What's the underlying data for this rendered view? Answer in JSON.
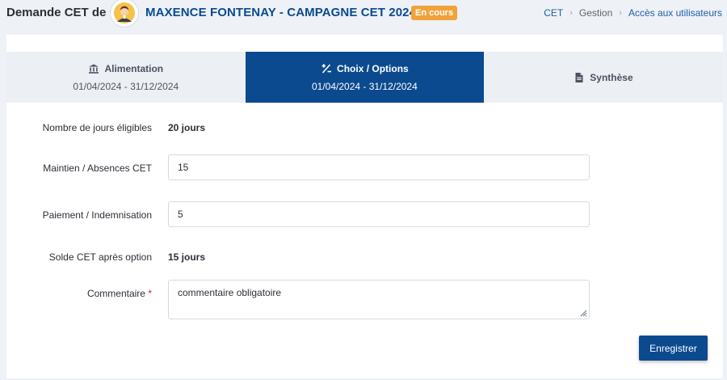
{
  "header": {
    "prefix": "Demande CET de",
    "person": "MAXENCE FONTENAY - CAMPAGNE CET 2024",
    "status_badge": "En cours",
    "breadcrumb": [
      "CET",
      "Gestion",
      "Accès aux utilisateurs"
    ]
  },
  "tabs": [
    {
      "label": "Alimentation",
      "dates": "01/04/2024 - 31/12/2024",
      "icon": "bank-icon",
      "active": false
    },
    {
      "label": "Choix / Options",
      "dates": "01/04/2024 - 31/12/2024",
      "icon": "percent-icon",
      "active": true
    },
    {
      "label": "Synthèse",
      "dates": "",
      "icon": "document-icon",
      "active": false
    }
  ],
  "form": {
    "eligible_label": "Nombre de jours éligibles",
    "eligible_value": "20 jours",
    "maintien_label": "Maintien / Absences CET",
    "maintien_value": "15",
    "paiement_label": "Paiement / Indemnisation",
    "paiement_value": "5",
    "solde_label": "Solde CET après option",
    "solde_value": "15 jours",
    "commentaire_label": "Commentaire",
    "commentaire_required": "*",
    "commentaire_value": "commentaire obligatoire"
  },
  "actions": {
    "save_label": "Enregistrer"
  },
  "colors": {
    "primary": "#0b4a8f",
    "badge": "#f0a23b",
    "required": "#d4262b"
  }
}
